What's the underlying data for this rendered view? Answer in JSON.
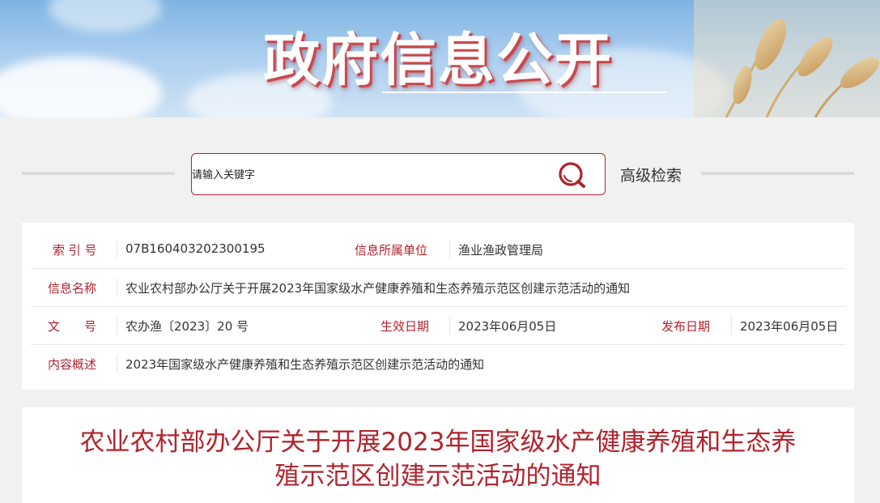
{
  "banner": {
    "title": "政府信息公开"
  },
  "search": {
    "placeholder": "请输入关键字",
    "advanced_label": "高级检索",
    "search_icon": "search-icon"
  },
  "info": {
    "index_label": "索 引 号",
    "index_value": "07B160403202300195",
    "unit_label": "信息所属单位",
    "unit_value": "渔业渔政管理局",
    "name_label": "信息名称",
    "name_value": "农业农村部办公厅关于开展2023年国家级水产健康养殖和生态养殖示范区创建示范活动的通知",
    "doc_label": "文　　号",
    "doc_value": "农办渔〔2023〕20 号",
    "effective_label": "生效日期",
    "effective_value": "2023年06月05日",
    "publish_label": "发布日期",
    "publish_value": "2023年06月05日",
    "summary_label": "内容概述",
    "summary_value": "2023年国家级水产健康养殖和生态养殖示范区创建示范活动的通知"
  },
  "article": {
    "title_line1": "农业农村部办公厅关于开展2023年国家级水产健康养殖和生态养",
    "title_line2": "殖示范区创建示范活动的通知"
  },
  "colors": {
    "accent": "#b1232d",
    "banner_sky": "#7db3e2"
  }
}
